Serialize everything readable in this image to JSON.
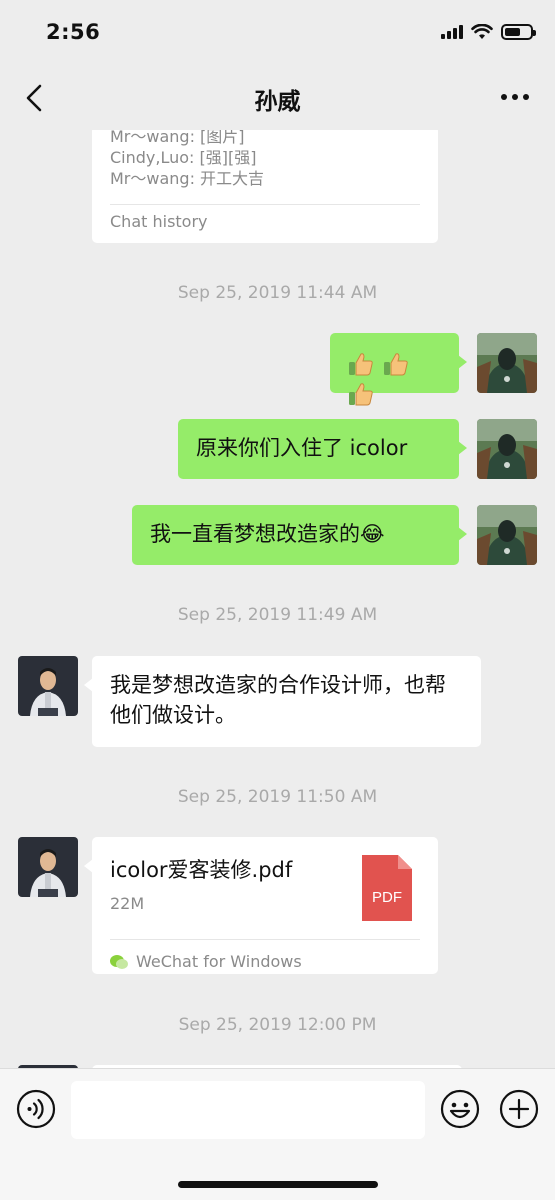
{
  "status_bar": {
    "time": "2:56",
    "battery_level": 0.62
  },
  "nav": {
    "title": "孙威"
  },
  "history_card": {
    "lines": [
      "Mr～wang: [图片]",
      "Cindy,Luo: [强][强]",
      "Mr～wang: 开工大吉"
    ],
    "footer": "Chat history"
  },
  "timestamps": [
    "Sep 25, 2019 11:44 AM",
    "Sep 25, 2019 11:49 AM",
    "Sep 25, 2019 11:50 AM",
    "Sep 25, 2019 12:00 PM"
  ],
  "messages": {
    "sent_1_emoji": "thumbs-up ×3",
    "sent_2": "原来你们入住了 icolor",
    "sent_3": "我一直看梦想改造家的😂",
    "received_1": "我是梦想改造家的合作设计师，也帮他们做设计。"
  },
  "file_message": {
    "name": "icolor爱客装修.pdf",
    "size": "22M",
    "icon_label": "PDF",
    "source": "WeChat for Windows"
  },
  "input": {
    "value": ""
  },
  "colors": {
    "sent_bubble": "#95ec69",
    "background": "#ededed",
    "pdf_red": "#e1534f"
  }
}
